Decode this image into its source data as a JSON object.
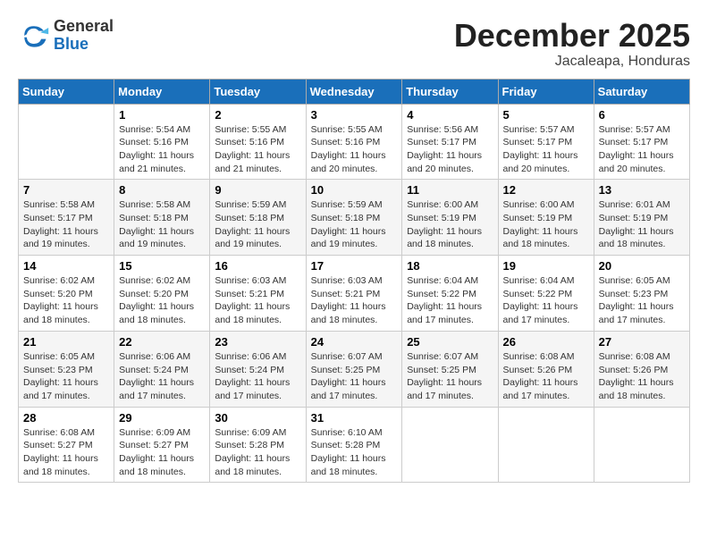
{
  "header": {
    "logo_general": "General",
    "logo_blue": "Blue",
    "month_title": "December 2025",
    "location": "Jacaleapa, Honduras"
  },
  "weekdays": [
    "Sunday",
    "Monday",
    "Tuesday",
    "Wednesday",
    "Thursday",
    "Friday",
    "Saturday"
  ],
  "weeks": [
    [
      {
        "day": "",
        "info": ""
      },
      {
        "day": "1",
        "info": "Sunrise: 5:54 AM\nSunset: 5:16 PM\nDaylight: 11 hours\nand 21 minutes."
      },
      {
        "day": "2",
        "info": "Sunrise: 5:55 AM\nSunset: 5:16 PM\nDaylight: 11 hours\nand 21 minutes."
      },
      {
        "day": "3",
        "info": "Sunrise: 5:55 AM\nSunset: 5:16 PM\nDaylight: 11 hours\nand 20 minutes."
      },
      {
        "day": "4",
        "info": "Sunrise: 5:56 AM\nSunset: 5:17 PM\nDaylight: 11 hours\nand 20 minutes."
      },
      {
        "day": "5",
        "info": "Sunrise: 5:57 AM\nSunset: 5:17 PM\nDaylight: 11 hours\nand 20 minutes."
      },
      {
        "day": "6",
        "info": "Sunrise: 5:57 AM\nSunset: 5:17 PM\nDaylight: 11 hours\nand 20 minutes."
      }
    ],
    [
      {
        "day": "7",
        "info": "Sunrise: 5:58 AM\nSunset: 5:17 PM\nDaylight: 11 hours\nand 19 minutes."
      },
      {
        "day": "8",
        "info": "Sunrise: 5:58 AM\nSunset: 5:18 PM\nDaylight: 11 hours\nand 19 minutes."
      },
      {
        "day": "9",
        "info": "Sunrise: 5:59 AM\nSunset: 5:18 PM\nDaylight: 11 hours\nand 19 minutes."
      },
      {
        "day": "10",
        "info": "Sunrise: 5:59 AM\nSunset: 5:18 PM\nDaylight: 11 hours\nand 19 minutes."
      },
      {
        "day": "11",
        "info": "Sunrise: 6:00 AM\nSunset: 5:19 PM\nDaylight: 11 hours\nand 18 minutes."
      },
      {
        "day": "12",
        "info": "Sunrise: 6:00 AM\nSunset: 5:19 PM\nDaylight: 11 hours\nand 18 minutes."
      },
      {
        "day": "13",
        "info": "Sunrise: 6:01 AM\nSunset: 5:19 PM\nDaylight: 11 hours\nand 18 minutes."
      }
    ],
    [
      {
        "day": "14",
        "info": "Sunrise: 6:02 AM\nSunset: 5:20 PM\nDaylight: 11 hours\nand 18 minutes."
      },
      {
        "day": "15",
        "info": "Sunrise: 6:02 AM\nSunset: 5:20 PM\nDaylight: 11 hours\nand 18 minutes."
      },
      {
        "day": "16",
        "info": "Sunrise: 6:03 AM\nSunset: 5:21 PM\nDaylight: 11 hours\nand 18 minutes."
      },
      {
        "day": "17",
        "info": "Sunrise: 6:03 AM\nSunset: 5:21 PM\nDaylight: 11 hours\nand 18 minutes."
      },
      {
        "day": "18",
        "info": "Sunrise: 6:04 AM\nSunset: 5:22 PM\nDaylight: 11 hours\nand 17 minutes."
      },
      {
        "day": "19",
        "info": "Sunrise: 6:04 AM\nSunset: 5:22 PM\nDaylight: 11 hours\nand 17 minutes."
      },
      {
        "day": "20",
        "info": "Sunrise: 6:05 AM\nSunset: 5:23 PM\nDaylight: 11 hours\nand 17 minutes."
      }
    ],
    [
      {
        "day": "21",
        "info": "Sunrise: 6:05 AM\nSunset: 5:23 PM\nDaylight: 11 hours\nand 17 minutes."
      },
      {
        "day": "22",
        "info": "Sunrise: 6:06 AM\nSunset: 5:24 PM\nDaylight: 11 hours\nand 17 minutes."
      },
      {
        "day": "23",
        "info": "Sunrise: 6:06 AM\nSunset: 5:24 PM\nDaylight: 11 hours\nand 17 minutes."
      },
      {
        "day": "24",
        "info": "Sunrise: 6:07 AM\nSunset: 5:25 PM\nDaylight: 11 hours\nand 17 minutes."
      },
      {
        "day": "25",
        "info": "Sunrise: 6:07 AM\nSunset: 5:25 PM\nDaylight: 11 hours\nand 17 minutes."
      },
      {
        "day": "26",
        "info": "Sunrise: 6:08 AM\nSunset: 5:26 PM\nDaylight: 11 hours\nand 17 minutes."
      },
      {
        "day": "27",
        "info": "Sunrise: 6:08 AM\nSunset: 5:26 PM\nDaylight: 11 hours\nand 18 minutes."
      }
    ],
    [
      {
        "day": "28",
        "info": "Sunrise: 6:08 AM\nSunset: 5:27 PM\nDaylight: 11 hours\nand 18 minutes."
      },
      {
        "day": "29",
        "info": "Sunrise: 6:09 AM\nSunset: 5:27 PM\nDaylight: 11 hours\nand 18 minutes."
      },
      {
        "day": "30",
        "info": "Sunrise: 6:09 AM\nSunset: 5:28 PM\nDaylight: 11 hours\nand 18 minutes."
      },
      {
        "day": "31",
        "info": "Sunrise: 6:10 AM\nSunset: 5:28 PM\nDaylight: 11 hours\nand 18 minutes."
      },
      {
        "day": "",
        "info": ""
      },
      {
        "day": "",
        "info": ""
      },
      {
        "day": "",
        "info": ""
      }
    ]
  ]
}
